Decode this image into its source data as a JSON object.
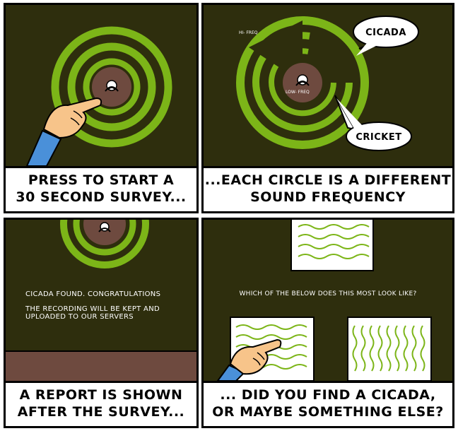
{
  "panels": [
    {
      "caption_line1": "PRESS TO START A",
      "caption_line2": "30 SECOND SURVEY..."
    },
    {
      "caption_line1": "...EACH CIRCLE IS A DIFFERENT",
      "caption_line2": "SOUND FREQUENCY",
      "label_hi": "HI- FREQ",
      "label_low": "LOW- FREQ",
      "bubble_cicada": "CICADA",
      "bubble_cricket": "CRICKET"
    },
    {
      "caption_line1": "A REPORT IS SHOWN",
      "caption_line2": "AFTER THE SURVEY...",
      "message_line1": "CICADA FOUND. CONGRATULATIONS",
      "message_line2": "THE RECORDING WILL BE KEPT AND",
      "message_line3": "UPLOADED TO OUR SERVERS"
    },
    {
      "caption_line1": "... DID YOU FIND A CICADA,",
      "caption_line2": "OR MAYBE SOMETHING ELSE?",
      "question": "WHICH OF THE BELOW DOES THIS MOST LOOK LIKE?"
    }
  ],
  "colors": {
    "background": "#2e2e0d",
    "ring": "#7cb518",
    "center": "#6e4a3f",
    "ground": "#6e4a3f"
  }
}
